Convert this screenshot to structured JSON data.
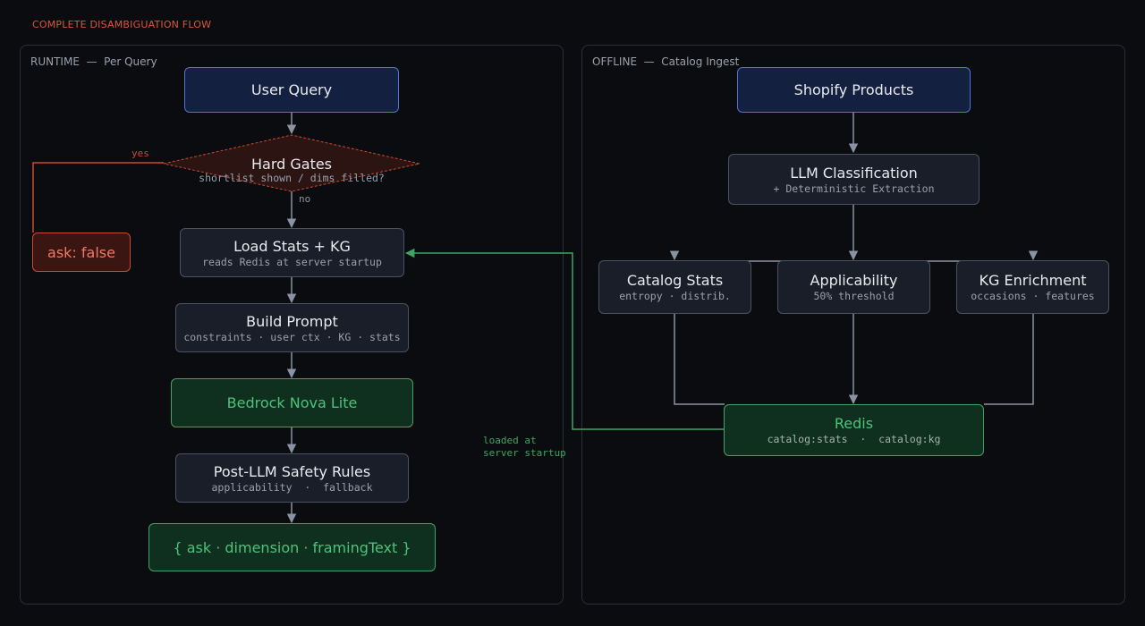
{
  "page_title": "COMPLETE DISAMBIGUATION FLOW",
  "runtime": {
    "label": "RUNTIME  —  Per Query",
    "user_query": "User Query",
    "hard_gates": {
      "title": "Hard Gates",
      "subtitle": "shortlist shown / dims filled?"
    },
    "yes_label": "yes",
    "no_label": "no",
    "ask_false": "ask: false",
    "load_stats": {
      "title": "Load Stats + KG",
      "subtitle": "reads Redis at server startup"
    },
    "build_prompt": {
      "title": "Build Prompt",
      "subtitle": "constraints · user ctx · KG · stats"
    },
    "bedrock": "Bedrock Nova Lite",
    "safety": {
      "title": "Post-LLM Safety Rules",
      "subtitle": "applicability  ·  fallback"
    },
    "output": "{ ask · dimension · framingText }"
  },
  "offline": {
    "label": "OFFLINE  —  Catalog Ingest",
    "shopify": "Shopify Products",
    "llm_class": {
      "title": "LLM Classification",
      "subtitle": "+ Deterministic Extraction"
    },
    "catalog_stats": {
      "title": "Catalog Stats",
      "subtitle": "entropy · distrib."
    },
    "applicability": {
      "title": "Applicability",
      "subtitle": "50% threshold"
    },
    "kg_enrichment": {
      "title": "KG Enrichment",
      "subtitle": "occasions · features"
    },
    "redis": {
      "title": "Redis",
      "subtitle": "catalog:stats  ·  catalog:kg"
    }
  },
  "link_label_1": "loaded at",
  "link_label_2": "server startup",
  "colors": {
    "accent_red": "#d9553c",
    "accent_green": "#4dc27a",
    "accent_blue": "#4f74d4",
    "wire": "#8a93a3"
  }
}
